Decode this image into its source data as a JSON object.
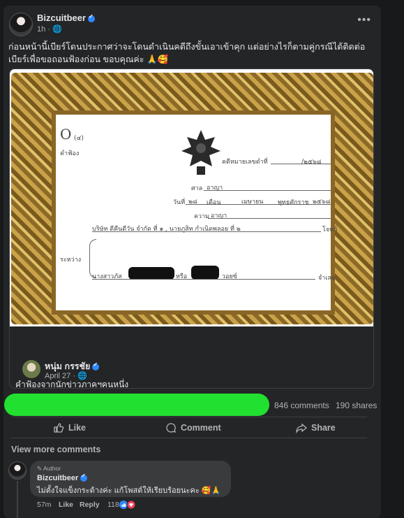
{
  "post": {
    "author": "Bizcuitbeer",
    "time": "1h",
    "privacy_icon": "globe-icon",
    "caption": "ก่อนหน้านี้เบียร์โดนประกาศว่าจะโดนดำเนินคดีถึงขั้นเอาเข้าคุก แต่อย่างไรก็ตามคู่กรณีได้ติดต่อเบียร์เพื่อขอถอนฟ้องก่อน ขอบคุณค่ะ 🙏🥰"
  },
  "document": {
    "form_code": "O",
    "form_number": "(๔)",
    "form_title": "คำฟ้อง",
    "case_label": "คดีหมายเลขดำที่",
    "case_value": "/๒๕๖๘",
    "court_label": "ศาล",
    "court_value": "อาญา",
    "date_label": "วันที่",
    "date_day": "๒๘",
    "month_label": "เดือน",
    "month_value": "เมษายน",
    "year_label": "พุทธศักราช",
    "year_value": "๒๕๖๘",
    "case_type_label": "ความ",
    "case_type_value": "อาญา",
    "between_label": "ระหว่าง",
    "plaintiff": "บริษัท ดีคืนดีวัน จำกัด ที่ ๑ , นายภูสิท กำเนิดพลอย ที่ ๒",
    "plaintiff_role": "โจทก์",
    "defendant_prefix": "นางสาวภัส",
    "defendant_or": "หรือ",
    "defendant_suffix": "วอยซ์",
    "defendant_role": "จำเลย"
  },
  "shared": {
    "author": "หนุ่ม กรรชัย",
    "time": "April 27",
    "privacy_icon": "globe-icon",
    "caption": "คำฟ้องจากนักข่าวภาคฯคนหนึ่ง"
  },
  "stats": {
    "comments": "846 comments",
    "shares": "190 shares"
  },
  "actions": {
    "like": "Like",
    "comment": "Comment",
    "share": "Share"
  },
  "comments": {
    "view_more": "View more comments",
    "items": [
      {
        "badge": "Author",
        "author": "Bizcuitbeer",
        "text": "ไม่ตั้งใจแข็งกระด้างค่ะ แก้โพสต์ให้เรียบร้อยนะคะ 🥰🙏",
        "time": "57m",
        "like_label": "Like",
        "reply_label": "Reply",
        "reaction_count": "118"
      }
    ]
  },
  "colors": {
    "background": "#18191a",
    "card": "#242526",
    "bubble": "#3a3b3c",
    "verified": "#2d88ff",
    "overlay_bar": "#22e030"
  }
}
